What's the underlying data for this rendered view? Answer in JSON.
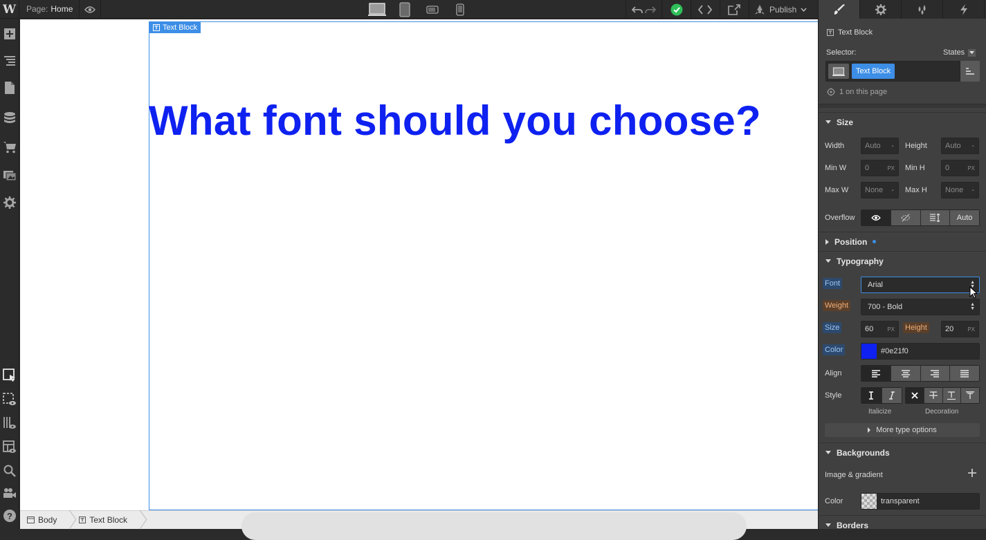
{
  "topbar": {
    "logo": "W",
    "page_prefix": "Page:",
    "page_name": "Home",
    "publish_label": "Publish"
  },
  "canvas": {
    "element_tag": "Text Block",
    "heading_text": "What font should you choose?",
    "heading_color": "#0e21f0"
  },
  "breadcrumb": {
    "items": [
      "Body",
      "Text Block"
    ]
  },
  "panel": {
    "element_name": "Text Block",
    "selector_label": "Selector:",
    "states_label": "States",
    "selector_chip": "Text Block",
    "on_page": "1 on this page",
    "size": {
      "title": "Size",
      "width_label": "Width",
      "width_value": "Auto",
      "height_label": "Height",
      "height_value": "Auto",
      "minw_label": "Min W",
      "minw_value": "0",
      "minw_unit": "PX",
      "minh_label": "Min H",
      "minh_value": "0",
      "minh_unit": "PX",
      "maxw_label": "Max W",
      "maxw_value": "None",
      "maxh_label": "Max H",
      "maxh_value": "None",
      "overflow_label": "Overflow",
      "overflow_auto": "Auto"
    },
    "position": {
      "title": "Position"
    },
    "typography": {
      "title": "Typography",
      "font_label": "Font",
      "font_value": "Arial",
      "weight_label": "Weight",
      "weight_value": "700 - Bold",
      "size_label": "Size",
      "size_value": "60",
      "size_unit": "PX",
      "lineheight_label": "Height",
      "lineheight_value": "20",
      "lineheight_unit": "PX",
      "color_label": "Color",
      "color_value": "#0e21f0",
      "align_label": "Align",
      "style_label": "Style",
      "italicize_label": "Italicize",
      "decoration_label": "Decoration",
      "more_options": "More type options"
    },
    "backgrounds": {
      "title": "Backgrounds",
      "image_gradient_label": "Image & gradient",
      "color_label": "Color",
      "color_value": "transparent"
    },
    "borders": {
      "title": "Borders"
    }
  },
  "colors": {
    "accent": "#3d8ee6",
    "heading": "#0e21f0",
    "success": "#2ecc71"
  }
}
